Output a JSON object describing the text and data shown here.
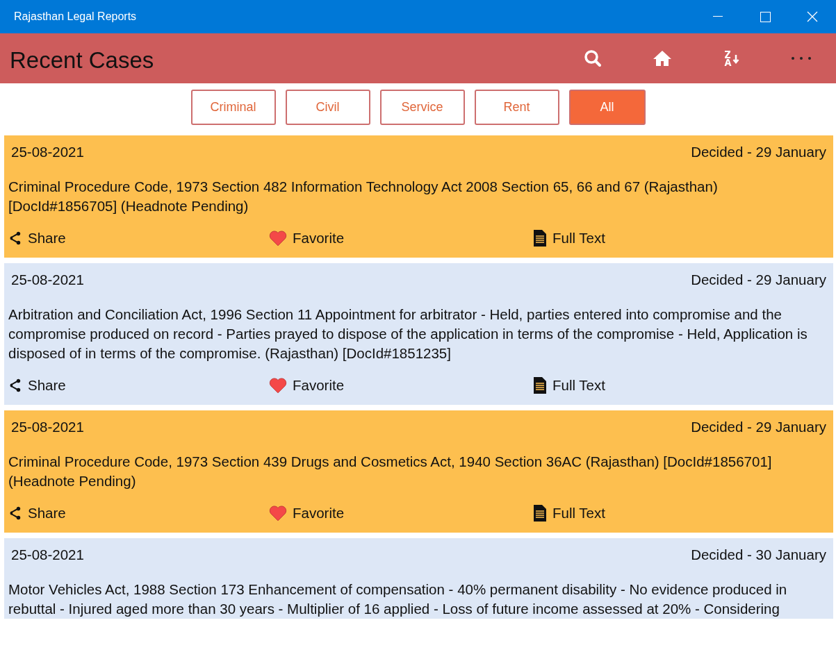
{
  "window": {
    "title": "Rajasthan Legal Reports"
  },
  "header": {
    "title": "Recent Cases"
  },
  "filters": [
    {
      "label": "Criminal",
      "selected": false
    },
    {
      "label": "Civil",
      "selected": false
    },
    {
      "label": "Service",
      "selected": false
    },
    {
      "label": "Rent",
      "selected": false
    },
    {
      "label": "All",
      "selected": true
    }
  ],
  "cases": [
    {
      "kind": "orange",
      "date": "25-08-2021",
      "decided": "Decided - 29 January",
      "text": "Criminal Procedure Code, 1973 Section 482 Information Technology Act 2008 Section 65, 66 and 67 (Rajasthan) [DocId#1856705] (Headnote Pending)",
      "actions": [
        "Share",
        "Favorite",
        "Full Text"
      ]
    },
    {
      "kind": "blue",
      "date": "25-08-2021",
      "decided": "Decided - 29 January",
      "text": "Arbitration and Conciliation Act, 1996 Section 11 Appointment for arbitrator - Held, parties entered into compromise and the compromise produced on record - Parties prayed to dispose of the application in terms of the compromise - Held, Application is disposed of in terms of the compromise. (Rajasthan) [DocId#1851235]",
      "actions": [
        "Share",
        "Favorite",
        "Full Text"
      ]
    },
    {
      "kind": "orange",
      "date": "25-08-2021",
      "decided": "Decided - 29 January",
      "text": "Criminal Procedure Code, 1973 Section 439 Drugs and Cosmetics Act, 1940 Section 36AC (Rajasthan) [DocId#1856701] (Headnote Pending)",
      "actions": [
        "Share",
        "Favorite",
        "Full Text"
      ]
    },
    {
      "kind": "blue",
      "date": "25-08-2021",
      "decided": "Decided - 30 January",
      "text": "Motor Vehicles Act, 1988 Section 173 Enhancement of compensation - 40% permanent disability - No evidence produced in rebuttal - Injured aged more than 30 years - Multiplier of 16 applied - Loss of future income assessed at 20% - Considering"
    }
  ]
}
